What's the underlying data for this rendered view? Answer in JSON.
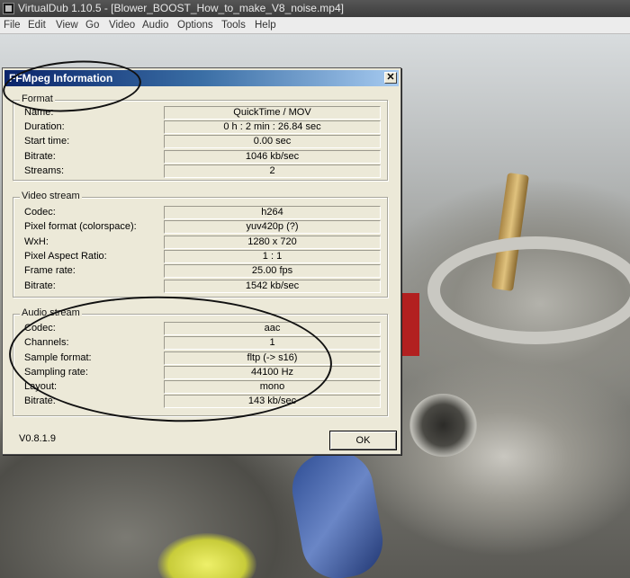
{
  "window": {
    "title": "VirtualDub 1.10.5 - [Blower_BOOST_How_to_make_V8_noise.mp4]",
    "icon": "virtualdub-app-icon"
  },
  "menu": [
    "File",
    "Edit",
    "View",
    "Go",
    "Video",
    "Audio",
    "Options",
    "Tools",
    "Help"
  ],
  "dialog": {
    "title": "FFMpeg Information",
    "close_glyph": "✕",
    "version": "V0.8.1.9",
    "ok_label": "OK",
    "groups": [
      {
        "title": "Format",
        "rows": [
          {
            "label": "Name:",
            "value": "QuickTime / MOV"
          },
          {
            "label": "Duration:",
            "value": "0 h : 2 min : 26.84 sec"
          },
          {
            "label": "Start time:",
            "value": "0.00 sec"
          },
          {
            "label": "Bitrate:",
            "value": "1046 kb/sec"
          },
          {
            "label": "Streams:",
            "value": "2"
          }
        ]
      },
      {
        "title": "Video stream",
        "rows": [
          {
            "label": "Codec:",
            "value": "h264"
          },
          {
            "label": "Pixel format (colorspace):",
            "value": "yuv420p (?)"
          },
          {
            "label": "WxH:",
            "value": "1280 x 720"
          },
          {
            "label": "Pixel Aspect Ratio:",
            "value": "1 : 1"
          },
          {
            "label": "Frame rate:",
            "value": "25.00 fps"
          },
          {
            "label": "Bitrate:",
            "value": "1542 kb/sec"
          }
        ]
      },
      {
        "title": "Audio stream",
        "rows": [
          {
            "label": "Codec:",
            "value": "aac"
          },
          {
            "label": "Channels:",
            "value": "1"
          },
          {
            "label": "Sample format:",
            "value": "fltp (-> s16)"
          },
          {
            "label": "Sampling rate:",
            "value": "44100 Hz"
          },
          {
            "label": "Layout:",
            "value": "mono"
          },
          {
            "label": "Bitrate:",
            "value": "143 kb/sec"
          }
        ]
      }
    ]
  }
}
